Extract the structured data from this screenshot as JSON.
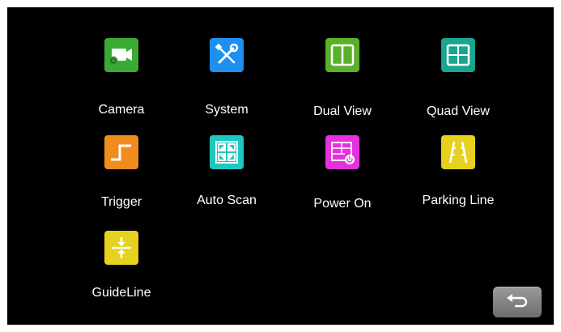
{
  "menu": {
    "items": [
      {
        "label": "Camera",
        "icon": "camera-icon",
        "color": "#3aaa35"
      },
      {
        "label": "System",
        "icon": "tools-icon",
        "color": "#1e90f0"
      },
      {
        "label": "Dual View",
        "icon": "dual-view-icon",
        "color": "#5ab02a"
      },
      {
        "label": "Quad View",
        "icon": "quad-view-icon",
        "color": "#1aa58e"
      },
      {
        "label": "Trigger",
        "icon": "trigger-icon",
        "color": "#f08c1e"
      },
      {
        "label": "Auto Scan",
        "icon": "auto-scan-icon",
        "color": "#1ec8c0"
      },
      {
        "label": "Power On",
        "icon": "power-on-icon",
        "color": "#e632dc"
      },
      {
        "label": "Parking Line",
        "icon": "parking-line-icon",
        "color": "#e6d21e"
      },
      {
        "label": "GuideLine",
        "icon": "guideline-icon",
        "color": "#e6d21e"
      }
    ]
  },
  "back_button": {
    "icon": "back-arrow-icon",
    "color": "#8a8a8a"
  }
}
